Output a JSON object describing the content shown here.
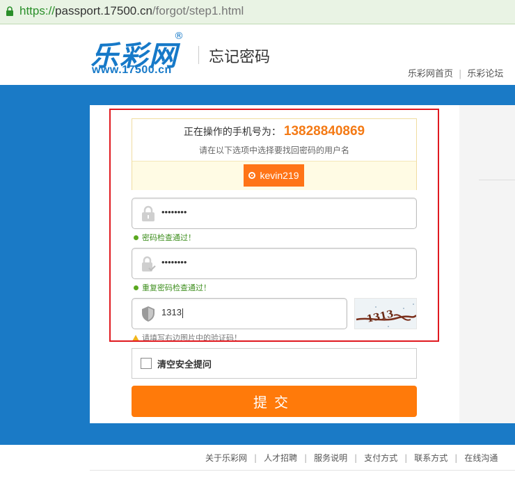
{
  "browser": {
    "url_protocol": "https://",
    "url_host": "passport.17500.cn",
    "url_path": "/forgot/step1.html"
  },
  "header": {
    "logo_text": "乐彩网",
    "logo_reg": "®",
    "logo_url": "www.17500.cn",
    "page_title": "忘记密码",
    "nav": [
      {
        "label": "乐彩网首页"
      },
      {
        "label": "乐彩论坛"
      }
    ]
  },
  "form": {
    "phone_label": "正在操作的手机号为：",
    "phone_number": "13828840869",
    "hint": "请在以下选项中选择要找回密码的用户名",
    "username_option": "kevin219",
    "password_value": "••••••••",
    "password_ok_msg": "密码检查通过！",
    "confirm_value": "••••••••",
    "confirm_ok_msg": "重复密码检查通过！",
    "captcha_value": "1313",
    "captcha_hint": "请填写右边图片中的验证码！",
    "captcha_image_text": "1313",
    "clear_security_label": "清空安全提问",
    "clear_security_checked": false,
    "submit_label": "提交"
  },
  "footer": {
    "links": [
      {
        "label": "关于乐彩网"
      },
      {
        "label": "人才招聘"
      },
      {
        "label": "服务说明"
      },
      {
        "label": "支付方式"
      },
      {
        "label": "联系方式"
      },
      {
        "label": "在线沟通"
      }
    ]
  },
  "colors": {
    "brand_blue": "#1a7ac6",
    "accent_orange": "#ff7a0a",
    "highlight_red": "#e0191f",
    "success_green": "#5aa81f"
  }
}
